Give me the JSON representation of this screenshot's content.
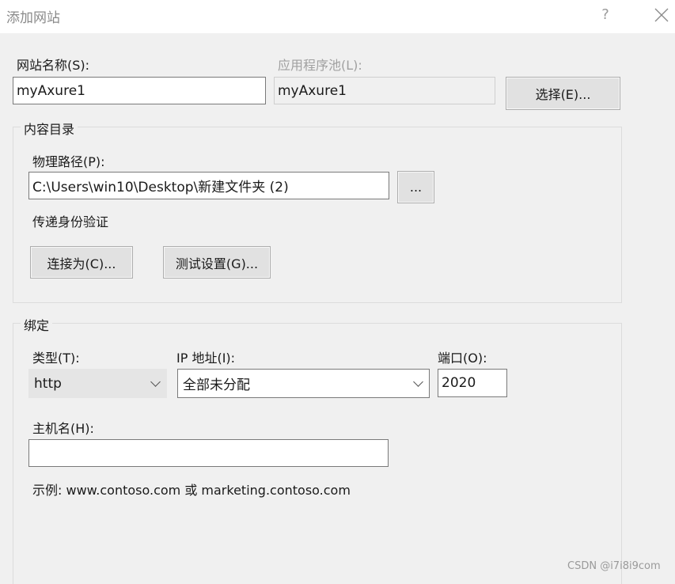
{
  "dialog": {
    "title": "添加网站",
    "help_glyph": "?",
    "close_icon": "close-icon"
  },
  "site_name": {
    "label": "网站名称(S):",
    "value": "myAxure1"
  },
  "app_pool": {
    "label": "应用程序池(L):",
    "value": "myAxure1",
    "select_button": "选择(E)..."
  },
  "content_directory": {
    "group_title": "内容目录",
    "physical_path_label": "物理路径(P):",
    "physical_path_value": "C:\\Users\\win10\\Desktop\\新建文件夹 (2)",
    "browse_button": "...",
    "pass_through_label": "传递身份验证",
    "connect_as_button": "连接为(C)...",
    "test_settings_button": "测试设置(G)..."
  },
  "binding": {
    "group_title": "绑定",
    "type_label": "类型(T):",
    "type_value": "http",
    "ip_label": "IP 地址(I):",
    "ip_value": "全部未分配",
    "port_label": "端口(O):",
    "port_value": "2020",
    "host_label": "主机名(H):",
    "host_value": "",
    "example_text": "示例: www.contoso.com 或 marketing.contoso.com"
  },
  "watermark": "CSDN @i7i8i9com",
  "colors": {
    "dialog_background": "#f0f0f0",
    "titlebar_background": "#ffffff",
    "button_face": "#e1e1e1",
    "disabled_text": "#a0a0a0"
  }
}
